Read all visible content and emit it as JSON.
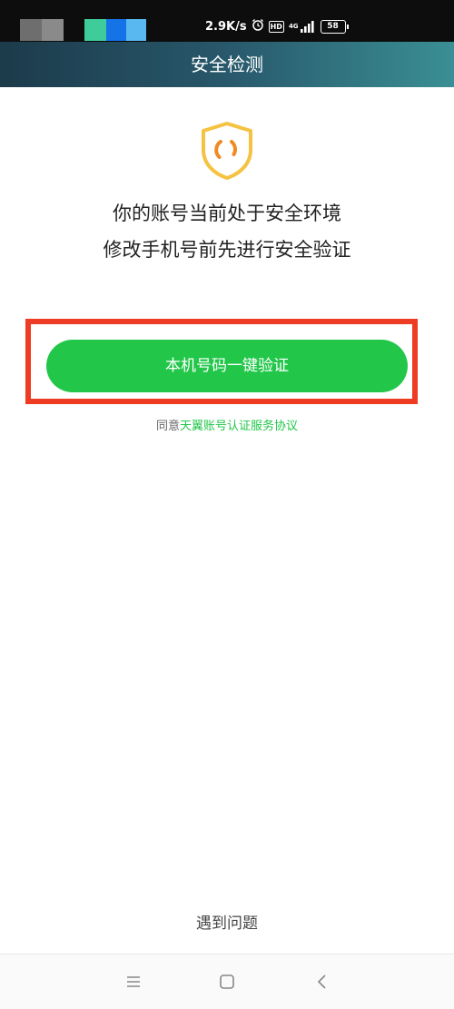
{
  "status_bar": {
    "net_speed": "2.9K/s",
    "alarm_icon": "alarm-clock-icon",
    "hd_label": "HD",
    "network_type": "4G",
    "battery_level": "58"
  },
  "header": {
    "title": "安全检测"
  },
  "main": {
    "shield_icon": "shield-icon",
    "message_line1": "你的账号当前处于安全环境",
    "message_line2": "修改手机号前先进行安全验证",
    "verify_button_label": "本机号码一键验证",
    "agreement_prefix": "同意",
    "agreement_link": "天翼账号认证服务协议"
  },
  "footer": {
    "problem_link": "遇到问题"
  },
  "nav_bar": {
    "menu_icon": "menu-icon",
    "home_icon": "home-icon",
    "back_icon": "back-icon"
  },
  "colors": {
    "accent_green": "#22c74a",
    "highlight_red": "#ee3b24",
    "shield_yellow": "#f5c242",
    "shield_orange": "#f08a24"
  }
}
